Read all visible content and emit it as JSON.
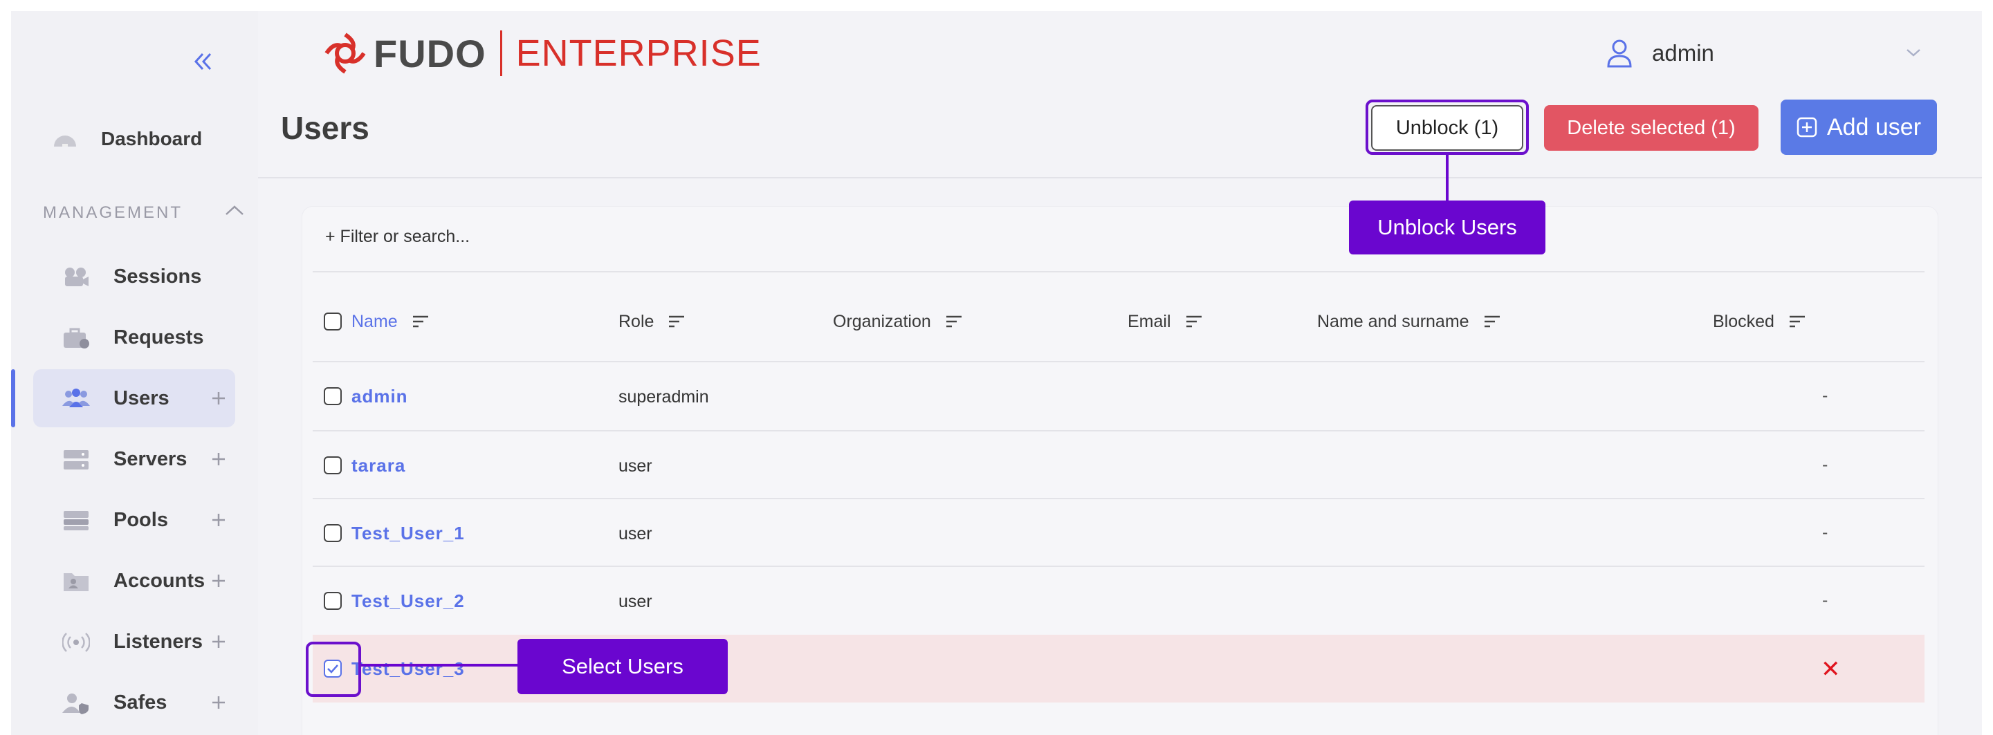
{
  "brand": {
    "name": "FUDO",
    "edition": "ENTERPRISE",
    "brand_color": "#d8302a"
  },
  "user_menu": {
    "username": "admin"
  },
  "sidebar": {
    "dashboard_label": "Dashboard",
    "section_label": "MANAGEMENT",
    "items": [
      {
        "label": "Sessions",
        "icon": "camera-icon",
        "has_add": false
      },
      {
        "label": "Requests",
        "icon": "briefcase-icon",
        "has_add": false
      },
      {
        "label": "Users",
        "icon": "users-icon",
        "has_add": true,
        "active": true
      },
      {
        "label": "Servers",
        "icon": "server-icon",
        "has_add": true
      },
      {
        "label": "Pools",
        "icon": "pool-icon",
        "has_add": true
      },
      {
        "label": "Accounts",
        "icon": "folder-user-icon",
        "has_add": true
      },
      {
        "label": "Listeners",
        "icon": "broadcast-icon",
        "has_add": true
      },
      {
        "label": "Safes",
        "icon": "user-shield-icon",
        "has_add": true
      }
    ]
  },
  "page": {
    "title": "Users",
    "unblock_label": "Unblock (1)",
    "delete_label": "Delete selected (1)",
    "add_label": "Add user"
  },
  "table": {
    "filter_placeholder": "+ Filter or search...",
    "columns": [
      "Name",
      "Role",
      "Organization",
      "Email",
      "Name and surname",
      "Blocked"
    ],
    "rows": [
      {
        "name": "admin",
        "role": "superadmin",
        "blocked": "-",
        "checked": false
      },
      {
        "name": "tarara",
        "role": "user",
        "blocked": "-",
        "checked": false
      },
      {
        "name": "Test_User_1",
        "role": "user",
        "blocked": "-",
        "checked": false
      },
      {
        "name": "Test_User_2",
        "role": "user",
        "blocked": "-",
        "checked": false
      },
      {
        "name": "Test_User_3",
        "role": "",
        "blocked": "✕",
        "checked": true
      }
    ]
  },
  "annotations": {
    "unblock": "Unblock Users",
    "select": "Select Users",
    "color": "#6a06cf"
  },
  "colors": {
    "accent": "#5a72e8",
    "danger": "#e25563",
    "blocked_mark": "#e0141e",
    "selected_row": "#f6e4e6"
  }
}
